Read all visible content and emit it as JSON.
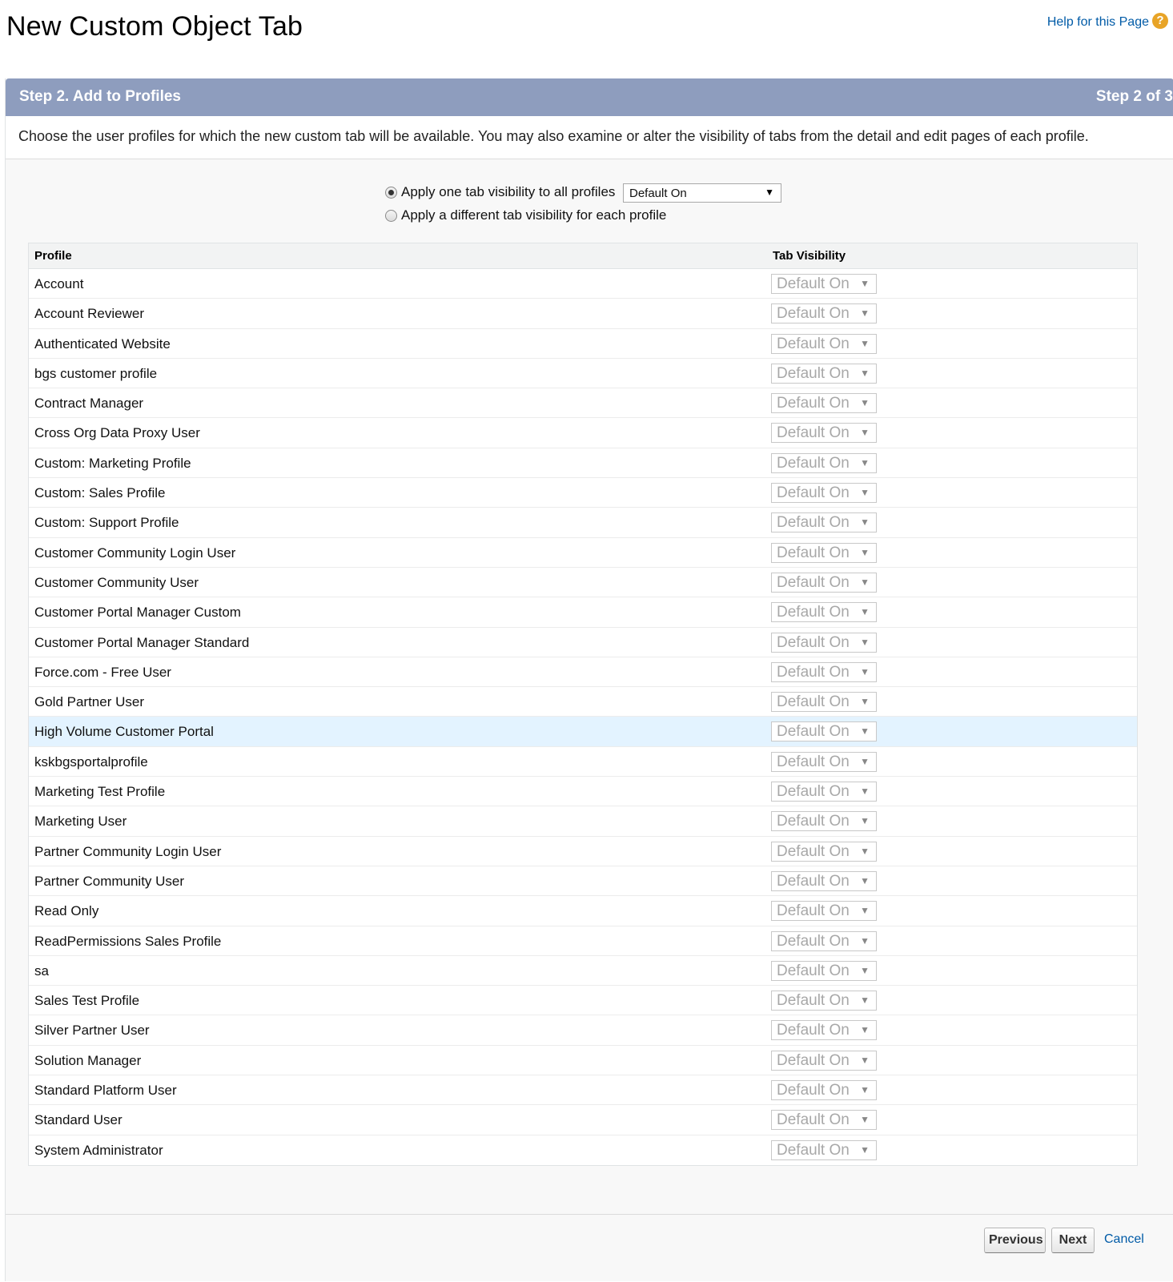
{
  "page": {
    "title": "New Custom Object Tab",
    "help_label": "Help for this Page",
    "help_icon": "?"
  },
  "step": {
    "title": "Step 2. Add to Profiles",
    "count": "Step 2 of 3",
    "description": "Choose the user profiles for which the new custom tab will be available. You may also examine or alter the visibility of tabs from the detail and edit pages of each profile."
  },
  "options": {
    "apply_all_label": "Apply one tab visibility to all profiles",
    "apply_each_label": "Apply a different tab visibility for each profile",
    "selected": "apply_all",
    "global_visibility": "Default On"
  },
  "table": {
    "headers": {
      "profile": "Profile",
      "visibility": "Tab Visibility"
    },
    "highlighted_row": "High Volume Customer Portal",
    "rows": [
      {
        "profile": "Account",
        "visibility": "Default On"
      },
      {
        "profile": "Account Reviewer",
        "visibility": "Default On"
      },
      {
        "profile": "Authenticated Website",
        "visibility": "Default On"
      },
      {
        "profile": "bgs customer profile",
        "visibility": "Default On"
      },
      {
        "profile": "Contract Manager",
        "visibility": "Default On"
      },
      {
        "profile": "Cross Org Data Proxy User",
        "visibility": "Default On"
      },
      {
        "profile": "Custom: Marketing Profile",
        "visibility": "Default On"
      },
      {
        "profile": "Custom: Sales Profile",
        "visibility": "Default On"
      },
      {
        "profile": "Custom: Support Profile",
        "visibility": "Default On"
      },
      {
        "profile": "Customer Community Login User",
        "visibility": "Default On"
      },
      {
        "profile": "Customer Community User",
        "visibility": "Default On"
      },
      {
        "profile": "Customer Portal Manager Custom",
        "visibility": "Default On"
      },
      {
        "profile": "Customer Portal Manager Standard",
        "visibility": "Default On"
      },
      {
        "profile": "Force.com - Free User",
        "visibility": "Default On"
      },
      {
        "profile": "Gold Partner User",
        "visibility": "Default On"
      },
      {
        "profile": "High Volume Customer Portal",
        "visibility": "Default On"
      },
      {
        "profile": "kskbgsportalprofile",
        "visibility": "Default On"
      },
      {
        "profile": "Marketing Test Profile",
        "visibility": "Default On"
      },
      {
        "profile": "Marketing User",
        "visibility": "Default On"
      },
      {
        "profile": "Partner Community Login User",
        "visibility": "Default On"
      },
      {
        "profile": "Partner Community User",
        "visibility": "Default On"
      },
      {
        "profile": "Read Only",
        "visibility": "Default On"
      },
      {
        "profile": "ReadPermissions Sales Profile",
        "visibility": "Default On"
      },
      {
        "profile": "sa",
        "visibility": "Default On"
      },
      {
        "profile": "Sales Test Profile",
        "visibility": "Default On"
      },
      {
        "profile": "Silver Partner User",
        "visibility": "Default On"
      },
      {
        "profile": "Solution Manager",
        "visibility": "Default On"
      },
      {
        "profile": "Standard Platform User",
        "visibility": "Default On"
      },
      {
        "profile": "Standard User",
        "visibility": "Default On"
      },
      {
        "profile": "System Administrator",
        "visibility": "Default On"
      }
    ]
  },
  "footer": {
    "previous_label": "Previous",
    "next_label": "Next",
    "cancel_label": "Cancel"
  },
  "colors": {
    "header_bar": "#8e9dbe",
    "link": "#015ba7",
    "help_icon": "#e8a427",
    "highlight_row": "#e3f3ff"
  },
  "icons": {
    "help": "help-icon",
    "dropdown": "chevron-down-icon"
  }
}
